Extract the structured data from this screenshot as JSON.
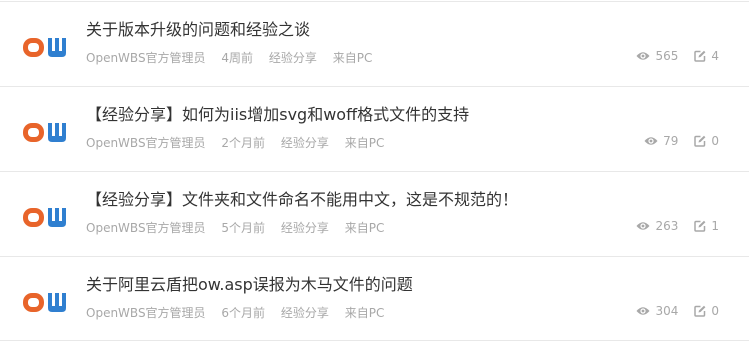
{
  "topics": [
    {
      "title": "关于版本升级的问题和经验之谈",
      "author": "OpenWBS官方管理员",
      "time": "4周前",
      "category": "经验分享",
      "source": "来自PC",
      "views": "565",
      "replies": "4"
    },
    {
      "title": "【经验分享】如何为iis增加svg和woff格式文件的支持",
      "author": "OpenWBS官方管理员",
      "time": "2个月前",
      "category": "经验分享",
      "source": "来自PC",
      "views": "79",
      "replies": "0"
    },
    {
      "title": "【经验分享】文件夹和文件命名不能用中文，这是不规范的！",
      "author": "OpenWBS官方管理员",
      "time": "5个月前",
      "category": "经验分享",
      "source": "来自PC",
      "views": "263",
      "replies": "1"
    },
    {
      "title": "关于阿里云盾把ow.asp误报为木马文件的问题",
      "author": "OpenWBS官方管理员",
      "time": "6个月前",
      "category": "经验分享",
      "source": "来自PC",
      "views": "304",
      "replies": "0"
    }
  ],
  "icons": {
    "avatar": "openwbs-ow-logo",
    "views": "eye-icon",
    "replies": "edit-icon"
  },
  "colors": {
    "logo_orange": "#e8642a",
    "logo_blue": "#2f7fd0",
    "title": "#333333",
    "meta": "#a8a8a8",
    "divider": "#e8e8e8"
  }
}
